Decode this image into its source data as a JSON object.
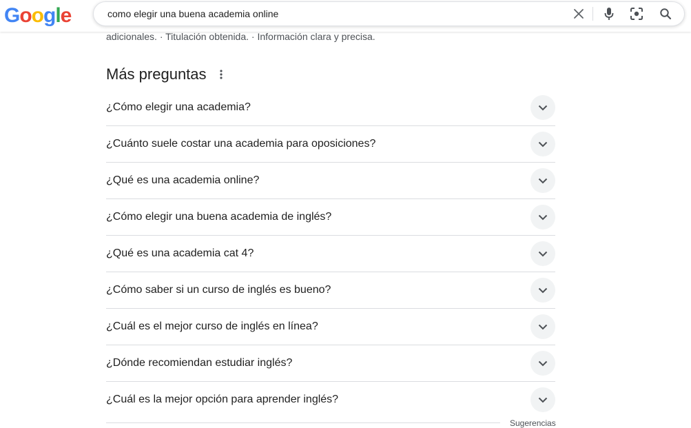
{
  "logo": {
    "letters": [
      "G",
      "o",
      "o",
      "g",
      "l",
      "e"
    ],
    "colors": [
      "#4285F4",
      "#EA4335",
      "#FBBC05",
      "#4285F4",
      "#34A853",
      "#EA4335"
    ]
  },
  "search": {
    "value": "como elegir una buena academia online",
    "icons": [
      "close-icon",
      "microphone-icon",
      "lens-icon",
      "search-icon"
    ]
  },
  "snippet": {
    "text": "adicionales. · Titulación obtenida. · Información clara y precisa."
  },
  "more_questions": {
    "title": "Más preguntas",
    "menu_icon": "more-vert-icon",
    "items": [
      {
        "label": "¿Cómo elegir una academia?"
      },
      {
        "label": "¿Cuánto suele costar una academia para oposiciones?"
      },
      {
        "label": "¿Qué es una academia online?"
      },
      {
        "label": "¿Cómo elegir una buena academia de inglés?"
      },
      {
        "label": "¿Qué es una academia cat 4?"
      },
      {
        "label": "¿Cómo saber si un curso de inglés es bueno?"
      },
      {
        "label": "¿Cuál es el mejor curso de inglés en línea?"
      },
      {
        "label": "¿Dónde recomiendan estudiar inglés?"
      },
      {
        "label": "¿Cuál es la mejor opción para aprender inglés?"
      }
    ]
  },
  "footer": {
    "label": "Sugerencias"
  }
}
